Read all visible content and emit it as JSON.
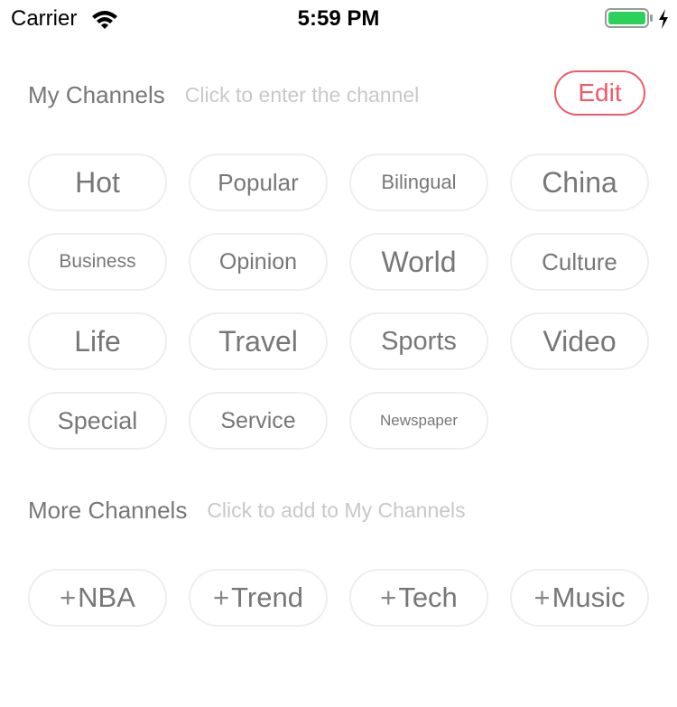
{
  "status_bar": {
    "carrier": "Carrier",
    "time": "5:59 PM",
    "battery_color": "#2bd15a"
  },
  "my_channels": {
    "title": "My Channels",
    "hint": "Click to enter the channel",
    "edit_label": "Edit",
    "accent_color": "#ef5a66",
    "items": [
      {
        "label": "Hot",
        "font": 32
      },
      {
        "label": "Popular",
        "font": 26
      },
      {
        "label": "Bilingual",
        "font": 22
      },
      {
        "label": "China",
        "font": 32
      },
      {
        "label": "Business",
        "font": 21
      },
      {
        "label": "Opinion",
        "font": 25
      },
      {
        "label": "World",
        "font": 32
      },
      {
        "label": "Culture",
        "font": 26
      },
      {
        "label": "Life",
        "font": 32
      },
      {
        "label": "Travel",
        "font": 32
      },
      {
        "label": "Sports",
        "font": 29
      },
      {
        "label": "Video",
        "font": 32
      },
      {
        "label": "Special",
        "font": 27
      },
      {
        "label": "Service",
        "font": 25
      },
      {
        "label": "Newspaper",
        "font": 17
      }
    ]
  },
  "more_channels": {
    "title": "More Channels",
    "hint": "Click to add to My Channels",
    "plus_icon": "+",
    "items": [
      {
        "label": "NBA",
        "font": 31
      },
      {
        "label": "Trend",
        "font": 31
      },
      {
        "label": "Tech",
        "font": 31
      },
      {
        "label": "Music",
        "font": 31
      }
    ]
  }
}
